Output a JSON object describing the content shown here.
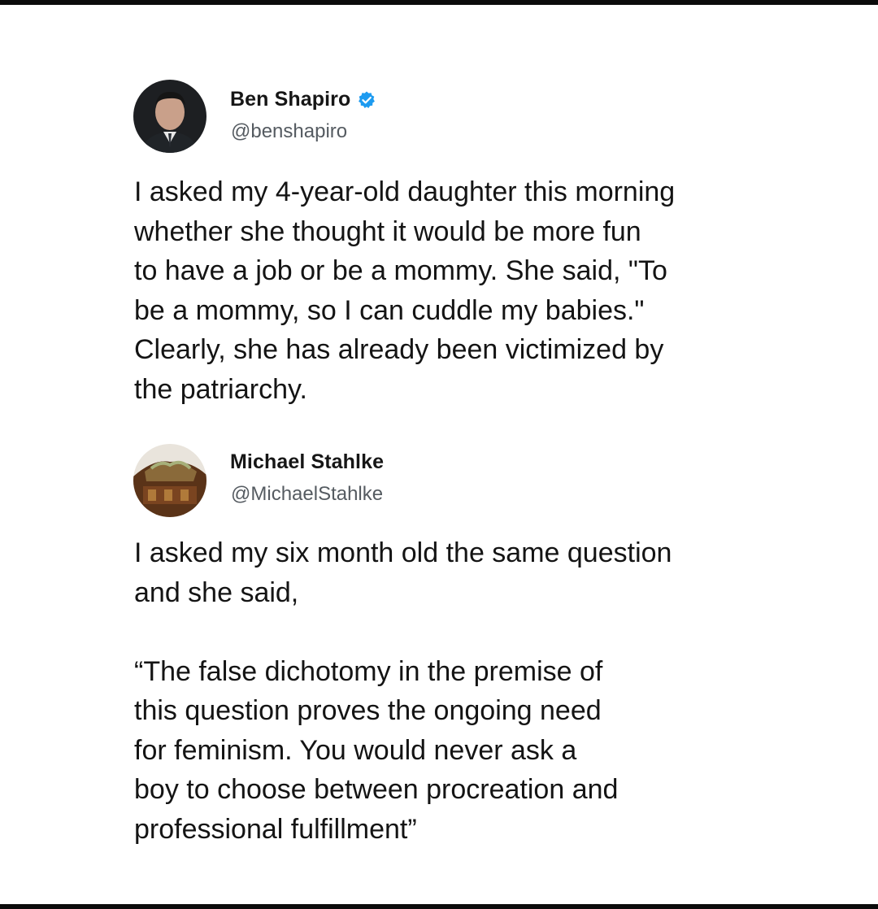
{
  "tweets": [
    {
      "display_name": "Ben Shapiro",
      "handle": "@benshapiro",
      "verified": true,
      "avatar_icon": "user-photo-avatar",
      "text": "I asked my 4-year-old daughter this morning\nwhether she thought it would be more fun\nto have a job or be a mommy. She said, \"To\nbe a mommy, so I can cuddle my babies.\"\nClearly, she has already been victimized by\nthe patriarchy."
    },
    {
      "display_name": "Michael Stahlke",
      "handle": "@MichaelStahlke",
      "verified": false,
      "avatar_icon": "photo-avatar",
      "text": "I asked my six month old the same question\nand she said,\n\n“The false dichotomy in the premise of\nthis question proves the ongoing need\nfor feminism. You would never ask a\nboy to choose between procreation and\nprofessional fulfillment”"
    }
  ],
  "colors": {
    "verified_badge": "#1d9bf0",
    "handle": "#555b61",
    "text": "#141414",
    "frame": "#0b0b0b"
  }
}
